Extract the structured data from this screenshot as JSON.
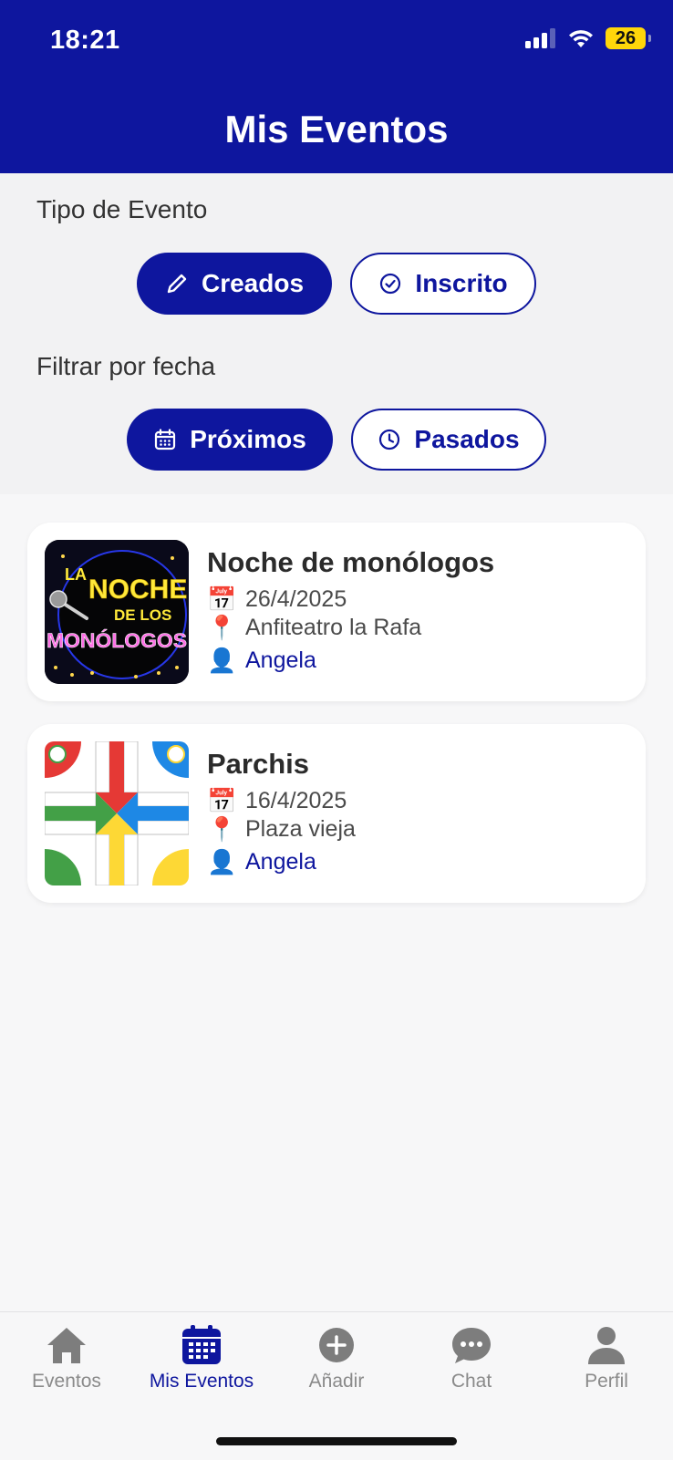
{
  "status_bar": {
    "time": "18:21",
    "battery": "26"
  },
  "header": {
    "title": "Mis Eventos"
  },
  "filters": {
    "type_label": "Tipo de Evento",
    "type_options": [
      {
        "label": "Creados",
        "icon": "pencil-icon",
        "active": true
      },
      {
        "label": "Inscrito",
        "icon": "check-circle-icon",
        "active": false
      }
    ],
    "date_label": "Filtrar por fecha",
    "date_options": [
      {
        "label": "Próximos",
        "icon": "calendar-icon",
        "active": true
      },
      {
        "label": "Pasados",
        "icon": "clock-icon",
        "active": false
      }
    ]
  },
  "events": [
    {
      "title": "Noche de monólogos",
      "date": "26/4/2025",
      "location": "Anfiteatro la Rafa",
      "organizer": "Angela",
      "thumb_text": [
        "LA",
        "NOCHE",
        "DE LOS",
        "MONÓLOGOS"
      ]
    },
    {
      "title": "Parchis",
      "date": "16/4/2025",
      "location": "Plaza vieja",
      "organizer": "Angela"
    }
  ],
  "tabbar": {
    "items": [
      {
        "label": "Eventos",
        "icon": "home-icon",
        "active": false
      },
      {
        "label": "Mis Eventos",
        "icon": "calendar-grid-icon",
        "active": true
      },
      {
        "label": "Añadir",
        "icon": "add-circle-icon",
        "active": false
      },
      {
        "label": "Chat",
        "icon": "chat-bubble-icon",
        "active": false
      },
      {
        "label": "Perfil",
        "icon": "person-icon",
        "active": false
      }
    ]
  },
  "colors": {
    "primary": "#0e169e",
    "battery": "#ffd60a"
  }
}
